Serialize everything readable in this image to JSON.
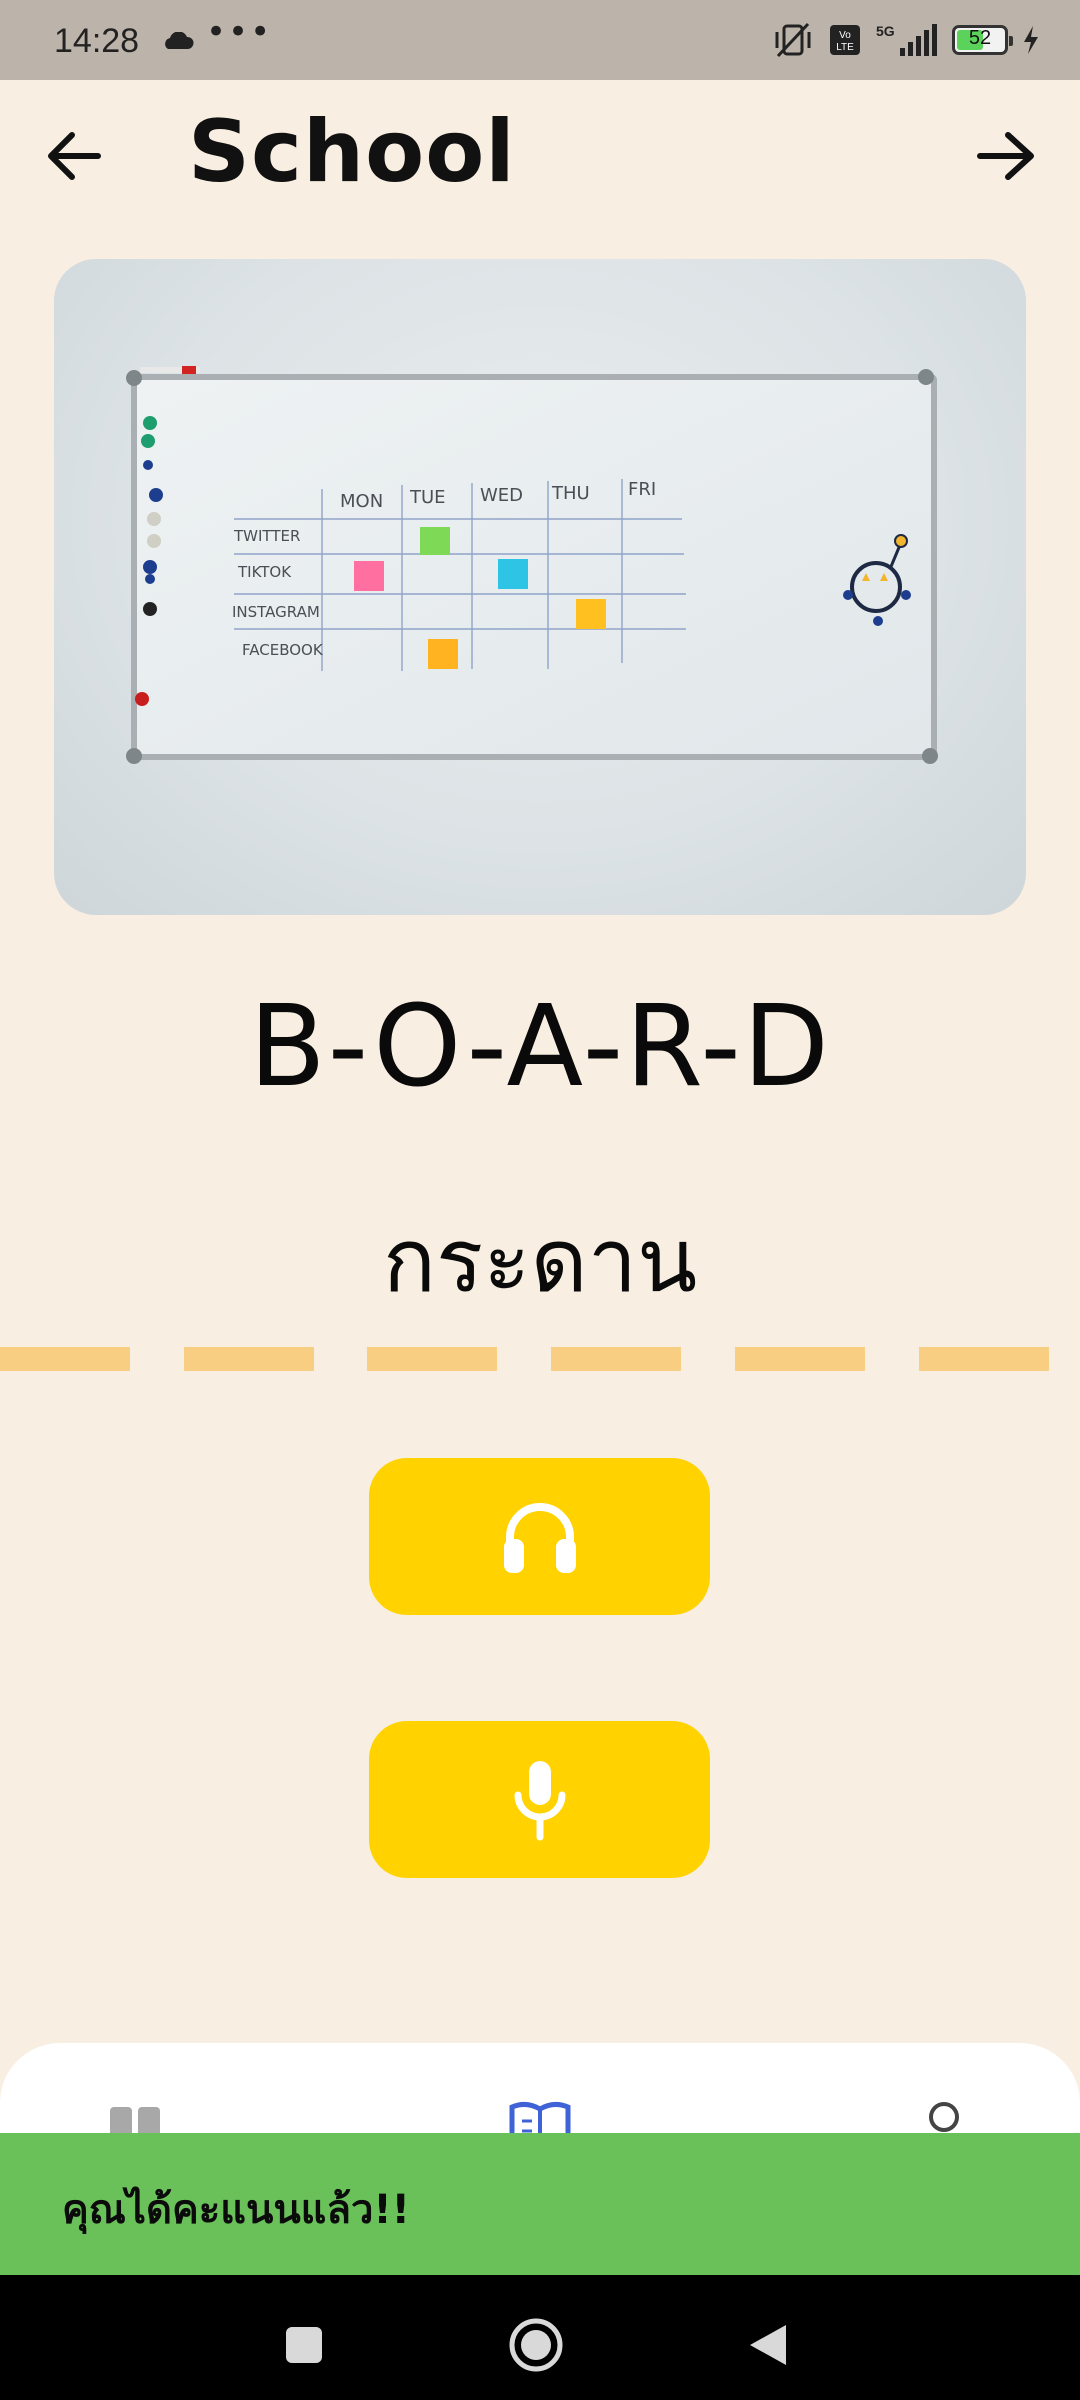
{
  "status_bar": {
    "time": "14:28",
    "more": "•••",
    "battery_level": "52",
    "battery_fraction": 0.52
  },
  "header": {
    "title": "School"
  },
  "image": {
    "board_days": [
      "MON",
      "TUE",
      "WED",
      "THU",
      "FRI"
    ],
    "board_rows": [
      "TWITTER",
      "TIKTOK",
      "INSTAGRAM",
      "FACEBOOK"
    ]
  },
  "card": {
    "word": "B-O-A-R-D",
    "translation": "กระดาน"
  },
  "actions": {
    "listen_icon": "headphones-icon",
    "speak_icon": "microphone-icon"
  },
  "bottom_nav": {
    "icons": [
      "grid-icon",
      "book-icon",
      "profile-icon"
    ]
  },
  "toast": {
    "message": "คุณได้คะแนนแล้ว!!"
  },
  "colors": {
    "background": "#F8EEE1",
    "accent": "#FFD200",
    "dash": "#F8CF82",
    "toast": "#6AC15A"
  }
}
